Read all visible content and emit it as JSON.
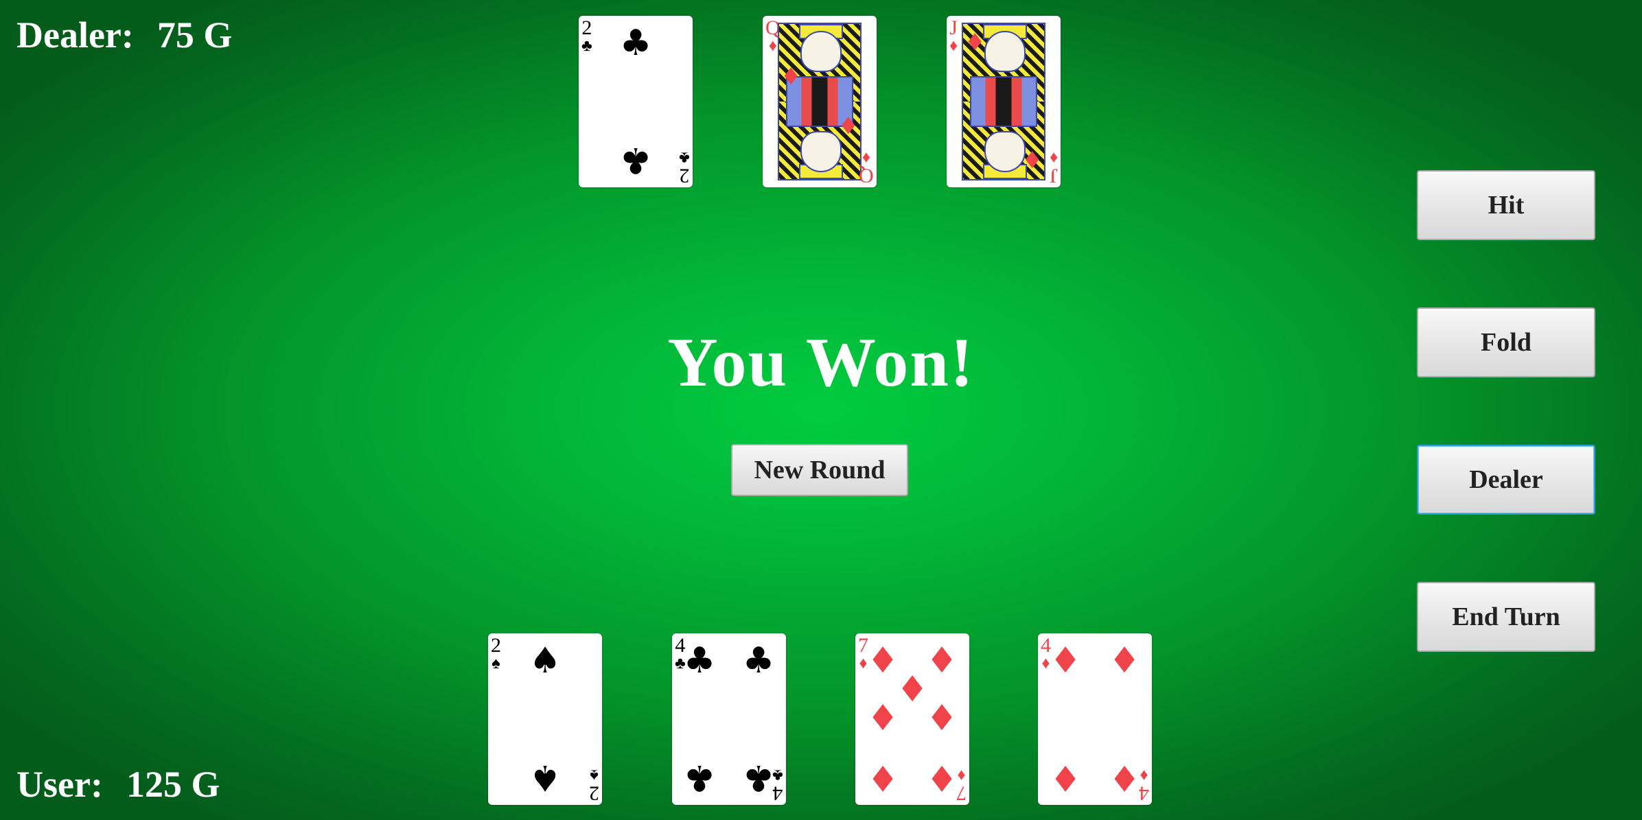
{
  "dealer": {
    "label": "Dealer:",
    "amount": "75 G"
  },
  "user": {
    "label": "User:",
    "amount": "125 G"
  },
  "message": "You Won!",
  "new_round_label": "New Round",
  "controls": {
    "hit": "Hit",
    "fold": "Fold",
    "dealer": "Dealer",
    "end_turn": "End Turn"
  },
  "dealer_hand": [
    {
      "rank": "2",
      "suit": "♣",
      "suit_name": "clubs",
      "color": "black"
    },
    {
      "rank": "Q",
      "suit": "♦",
      "suit_name": "diamonds",
      "color": "red"
    },
    {
      "rank": "J",
      "suit": "♦",
      "suit_name": "diamonds",
      "color": "red"
    }
  ],
  "user_hand": [
    {
      "rank": "2",
      "suit": "♠",
      "suit_name": "spades",
      "color": "black"
    },
    {
      "rank": "4",
      "suit": "♣",
      "suit_name": "clubs",
      "color": "black"
    },
    {
      "rank": "7",
      "suit": "♦",
      "suit_name": "diamonds",
      "color": "red"
    },
    {
      "rank": "4",
      "suit": "♦",
      "suit_name": "diamonds",
      "color": "red"
    }
  ],
  "colors": {
    "table_center": "#00cc40",
    "table_edge": "#045c1b",
    "red_suit": "#f0434a",
    "black_suit": "#000000"
  }
}
